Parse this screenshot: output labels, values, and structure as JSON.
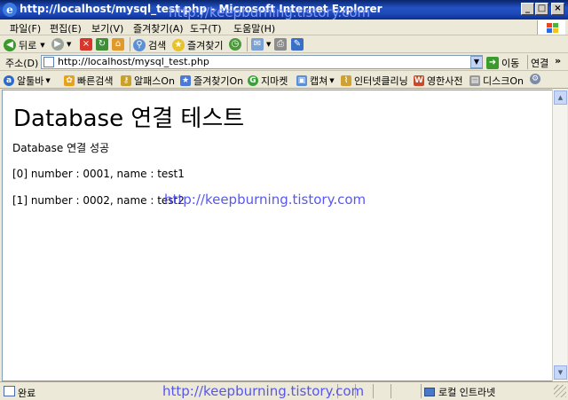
{
  "window": {
    "title": "http://localhost/mysql_test.php - Microsoft Internet Explorer"
  },
  "menu": [
    "파일(F)",
    "편집(E)",
    "보기(V)",
    "즐겨찾기(A)",
    "도구(T)",
    "도움말(H)"
  ],
  "toolbar": {
    "back": "뒤로",
    "search": "검색",
    "favorites": "즐겨찾기"
  },
  "address": {
    "label": "주소(D)",
    "value": "http://localhost/mysql_test.php",
    "go": "이동",
    "links": "연결"
  },
  "links": {
    "alltoolbar": "알툴바",
    "quicksearch": "빠른검색",
    "alpass": "알패스On",
    "favon": "즐겨찾기On",
    "gmarket": "지마켓",
    "capture": "캡쳐",
    "cleaning": "인터넷클리닝",
    "dictionary": "영한사전",
    "diskon": "디스크On"
  },
  "page": {
    "heading": "Database 연결 테스트",
    "status_line": "Database 연결 성공",
    "rows": [
      "[0] number : 0001, name : test1",
      "[1] number : 0002, name : test2"
    ]
  },
  "status": {
    "text": "완료",
    "zone": "로컬 인트라넷"
  },
  "watermark": "http://keepburning.tistory.com",
  "colors": {
    "titlebar": "#0a246a",
    "watermark": "#4a4af0",
    "chrome": "#ece9d8"
  }
}
